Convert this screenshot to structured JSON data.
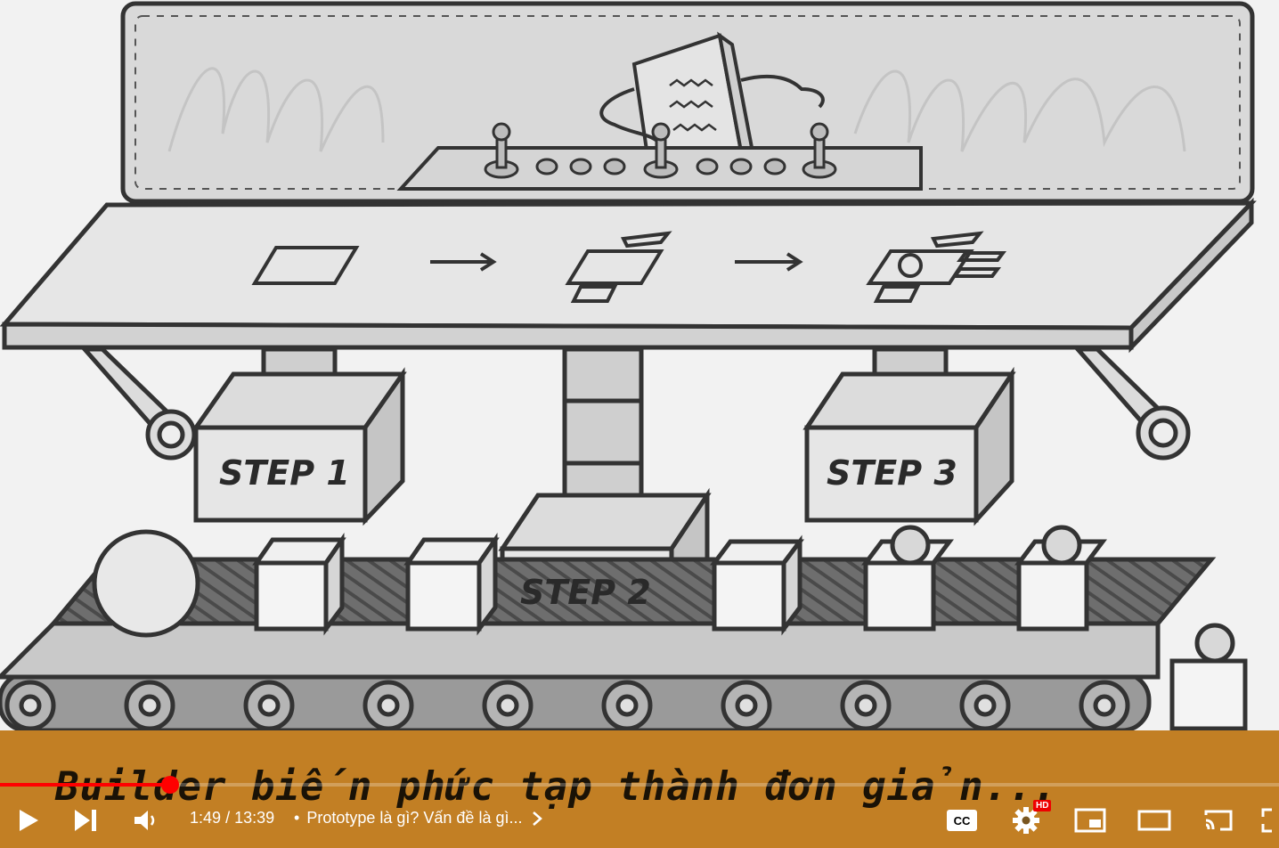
{
  "video": {
    "steps": [
      "STEP 1",
      "STEP 2",
      "STEP 3"
    ],
    "subtitle": "Builder biến phức tạp thành đơn giản..."
  },
  "player": {
    "current_time": "1:49",
    "separator": "/",
    "duration": "13:39",
    "chapter_title": "Prototype là gì? Vấn đề là gì...",
    "progress_fraction": 0.133,
    "hd_badge": "HD",
    "cc_label": "CC",
    "accent": "#ff0000"
  },
  "icons": [
    "play-icon",
    "next-icon",
    "volume-icon",
    "chevron-right-icon",
    "captions-icon",
    "settings-icon",
    "miniplayer-icon",
    "theater-icon",
    "cast-icon",
    "fullscreen-icon"
  ]
}
